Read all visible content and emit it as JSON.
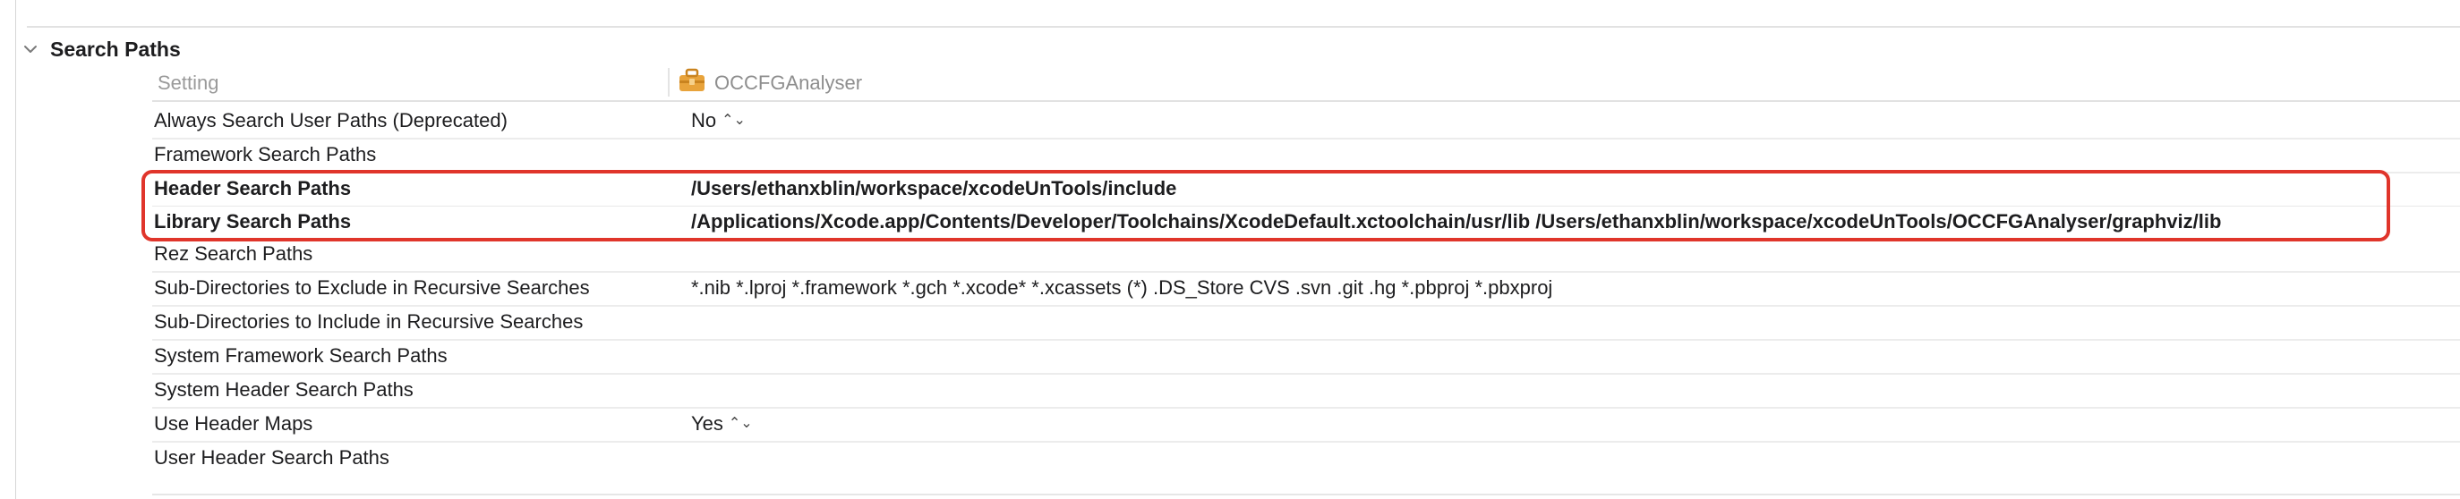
{
  "section": {
    "title": "Search Paths"
  },
  "columns": {
    "setting": "Setting",
    "target": "OCCFGAnalyser",
    "target_icon": "toolbox-icon"
  },
  "rows": [
    {
      "name": "Always Search User Paths (Deprecated)",
      "value": "No",
      "has_stepper": true,
      "bold": false
    },
    {
      "name": "Framework Search Paths",
      "value": "",
      "bold": false
    },
    {
      "name": "Header Search Paths",
      "value": "/Users/ethanxblin/workspace/xcodeUnTools/include",
      "bold": true
    },
    {
      "name": "Library Search Paths",
      "value": "/Applications/Xcode.app/Contents/Developer/Toolchains/XcodeDefault.xctoolchain/usr/lib /Users/ethanxblin/workspace/xcodeUnTools/OCCFGAnalyser/graphviz/lib",
      "bold": true
    },
    {
      "name": "Rez Search Paths",
      "value": "",
      "bold": false
    },
    {
      "name": "Sub-Directories to Exclude in Recursive Searches",
      "value": "*.nib *.lproj *.framework *.gch *.xcode* *.xcassets (*) .DS_Store CVS .svn .git .hg *.pbproj *.pbxproj",
      "bold": false
    },
    {
      "name": "Sub-Directories to Include in Recursive Searches",
      "value": "",
      "bold": false
    },
    {
      "name": "System Framework Search Paths",
      "value": "",
      "bold": false
    },
    {
      "name": "System Header Search Paths",
      "value": "",
      "bold": false
    },
    {
      "name": "Use Header Maps",
      "value": "Yes",
      "has_stepper": true,
      "bold": false
    },
    {
      "name": "User Header Search Paths",
      "value": "",
      "bold": false
    }
  ],
  "stepper_glyph": "⌃⌄",
  "colors": {
    "highlight": "#e0352b",
    "toolbox": "#e8a33b"
  }
}
